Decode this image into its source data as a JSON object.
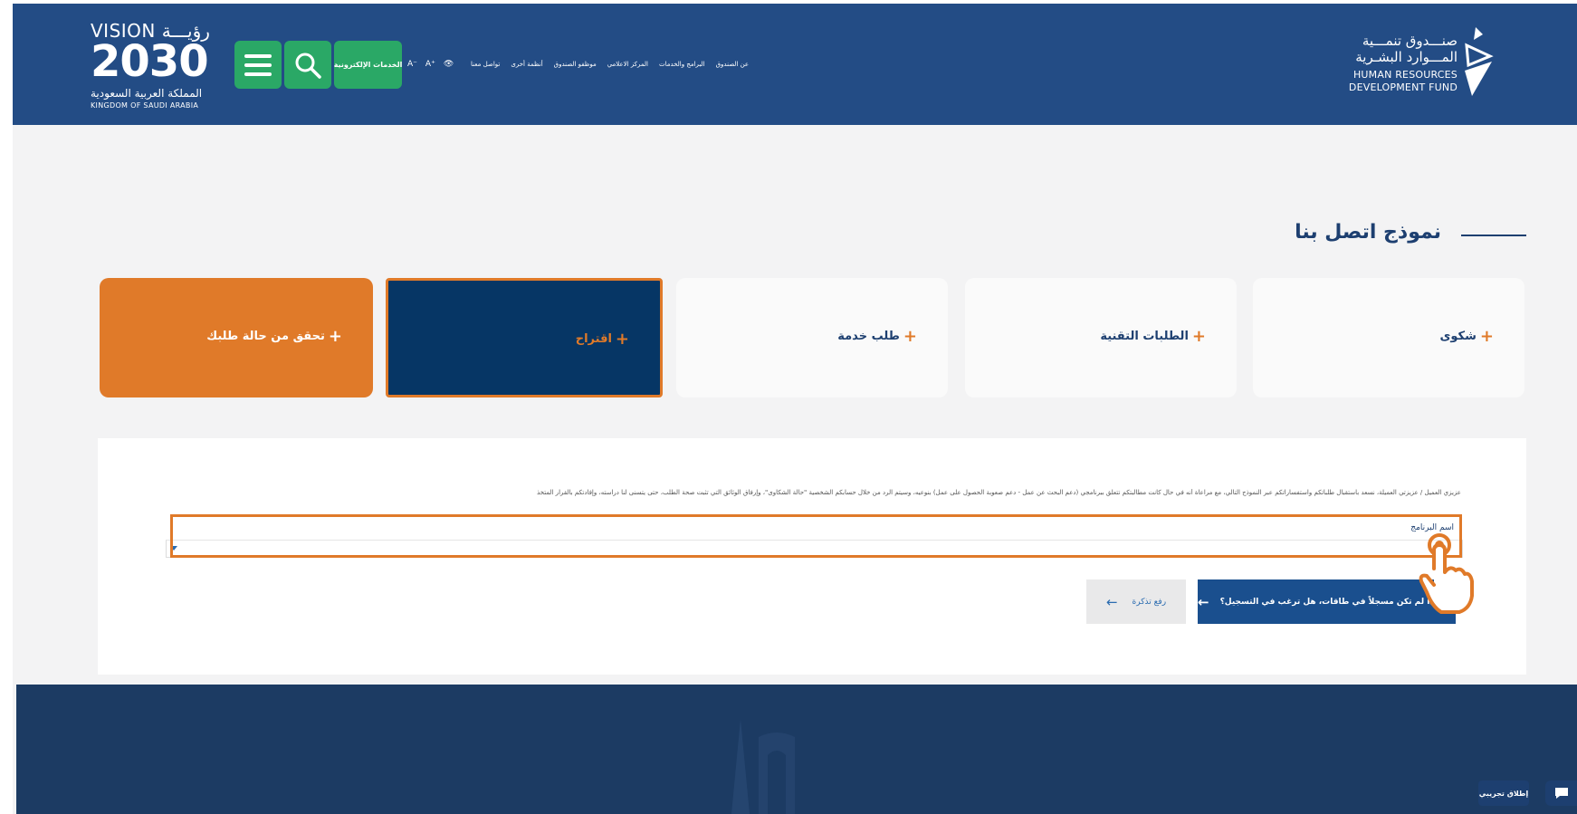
{
  "header": {
    "vision": {
      "top": "VISION رؤيـــة",
      "year": "2030",
      "arabic": "المملكة العربية السعودية",
      "english": "KINGDOM OF SAUDI ARABIA"
    },
    "eservices_label": "الخدمات الإلكترونية",
    "tools": [
      "A⁻",
      "A⁺",
      "👁"
    ],
    "nav": [
      "عن الصندوق",
      "البرامج والخدمات",
      "المركز الاعلامي",
      "موظفو الصندوق",
      "أنظمة أخرى",
      "تواصل معنا"
    ],
    "logo": {
      "ar_line1": "صنـــدوق تنمـــية",
      "ar_line2": "المـــوارد البشـرية",
      "en_line1": "HUMAN RESOURCES",
      "en_line2": "DEVELOPMENT FUND"
    }
  },
  "page_title": "نموذج اتصل بنا",
  "cards": {
    "complaint": "شكوى",
    "tech": "الطلبات التقنية",
    "service": "طلب خدمة",
    "suggestion": "اقتراح",
    "status": "تحقق من حالة طلبك",
    "plus": "+"
  },
  "form": {
    "intro": "عزيزي العميل / عزيزتي العميلة، نسعد باستقبال طلباتكم واستفساراتكم عبر النموذج التالي، مع مراعاة أنه في حال كانت مطالبتكم تتعلق ببرنامجي (دعم البحث عن عمل - دعم صعوبة الحصول على عمل) بنوعيه، وسيتم الرد من خلال حسابكم الشخصية \"حالة الشكاوى\"، وإرفاق الوثائق التي تثبت صحة الطلب، حتى يتسنى لنا دراسته، وإفادتكم بالقرار المتخذ",
    "program_label": "اسم البرنامج",
    "register_button": "إذا لم تكن مسجلاً في طاقات، هل ترغب في التسجيل؟",
    "ticket_button": "رفع تذكرة",
    "arrow": "←"
  },
  "widget": {
    "chat_label": "إطلاق تجريبي"
  },
  "colors": {
    "header_blue": "#234c85",
    "green": "#2aa866",
    "orange": "#e07a29",
    "navy": "#063665"
  }
}
